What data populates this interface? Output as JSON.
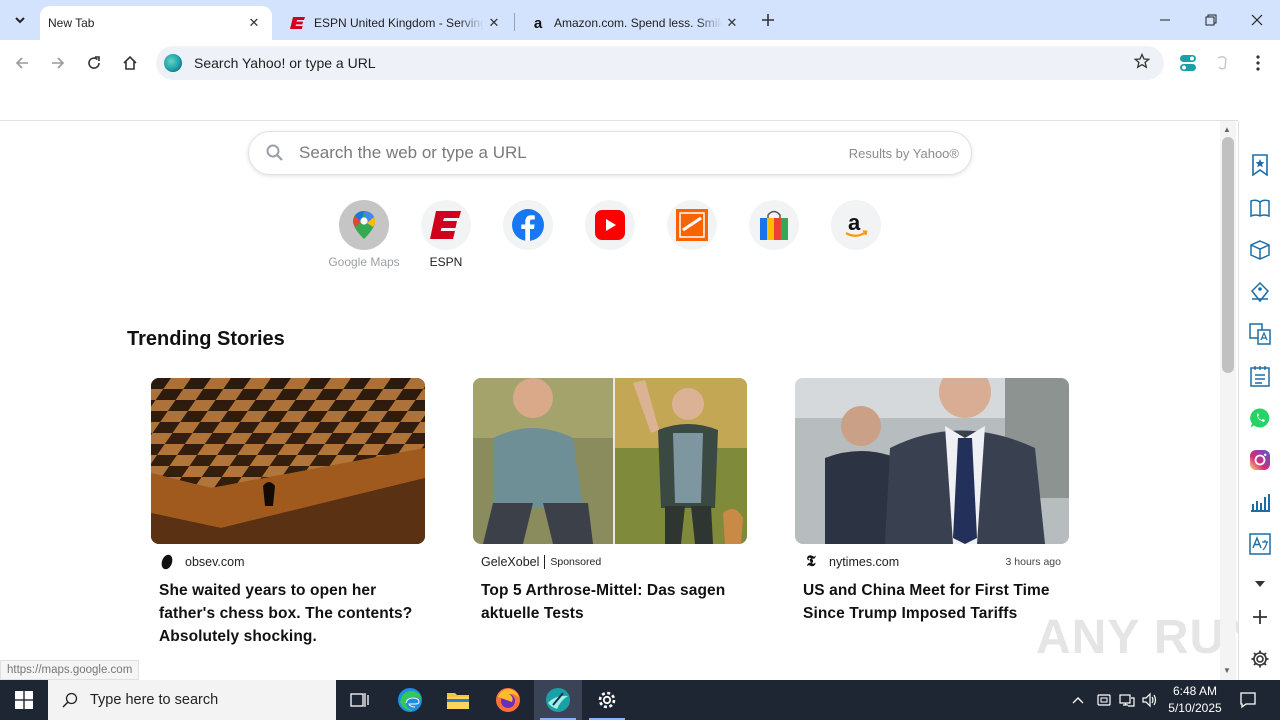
{
  "browser": {
    "tabs": [
      {
        "title": "New Tab",
        "active": true
      },
      {
        "title": "ESPN United Kingdom - Serving",
        "active": false
      },
      {
        "title": "Amazon.com. Spend less. Smile",
        "active": false
      }
    ],
    "omnibox": {
      "text": "Search Yahoo! or type a URL"
    }
  },
  "newtab": {
    "search": {
      "placeholder": "Search the web or type a URL",
      "provider": "Results by Yahoo®"
    },
    "shortcuts": [
      {
        "label": "Google Maps",
        "icon": "google-maps-icon"
      },
      {
        "label": "ESPN",
        "icon": "espn-icon"
      },
      {
        "label": "",
        "icon": "facebook-icon"
      },
      {
        "label": "",
        "icon": "youtube-icon"
      },
      {
        "label": "",
        "icon": "home-depot-icon"
      },
      {
        "label": "",
        "icon": "shopping-bag-icon"
      },
      {
        "label": "",
        "icon": "amazon-icon"
      }
    ],
    "trending_title": "Trending Stories",
    "stories": [
      {
        "source": "obsev.com",
        "sponsored": "",
        "time": "",
        "headline": "She waited years to open her father's chess box. The contents? Absolutely shocking."
      },
      {
        "source": "GeleXobel",
        "sponsored": "Sponsored",
        "time": "",
        "headline": "Top 5 Arthrose-Mittel: Das sagen aktuelle Tests"
      },
      {
        "source": "nytimes.com",
        "sponsored": "",
        "time": "3 hours ago",
        "headline": "US and China Meet for First Time Since Trump Imposed Tariffs"
      }
    ]
  },
  "status_url": "https://maps.google.com",
  "watermark": "ANY RUN",
  "taskbar": {
    "search_placeholder": "Type here to search",
    "time": "6:48 AM",
    "date": "5/10/2025"
  },
  "colors": {
    "accent": "#d3e3fd",
    "taskbar": "#1f2633",
    "espn_red": "#d0021b"
  }
}
